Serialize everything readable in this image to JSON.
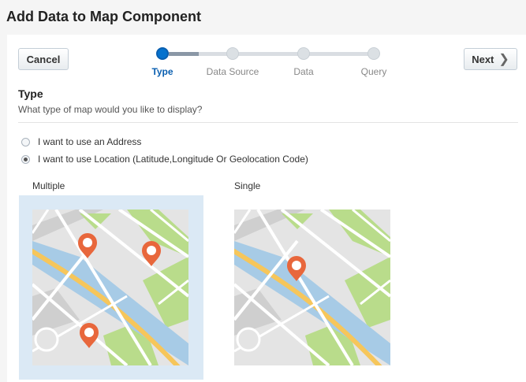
{
  "dialog": {
    "title": "Add Data to Map Component"
  },
  "toolbar": {
    "cancel_label": "Cancel",
    "next_label": "Next"
  },
  "train": {
    "steps": [
      {
        "label": "Type",
        "state": "current"
      },
      {
        "label": "Data Source",
        "state": "pending"
      },
      {
        "label": "Data",
        "state": "pending"
      },
      {
        "label": "Query",
        "state": "pending"
      }
    ]
  },
  "section": {
    "title": "Type",
    "question": "What type of map would you like to display?"
  },
  "radios": [
    {
      "label": "I want to use an Address",
      "checked": false
    },
    {
      "label": "I want to use Location (Latitude,Longitude Or Geolocation Code)",
      "checked": true
    }
  ],
  "options": [
    {
      "label": "Multiple",
      "selected": true,
      "icon": "map-multiple-pins-icon"
    },
    {
      "label": "Single",
      "selected": false,
      "icon": "map-single-pin-icon"
    }
  ],
  "colors": {
    "accent": "#0572ce",
    "pin": "#e8673c",
    "water": "#a7cbe6",
    "park": "#b9dc8b",
    "road": "#f6c65b",
    "selection": "#dbe9f5"
  }
}
